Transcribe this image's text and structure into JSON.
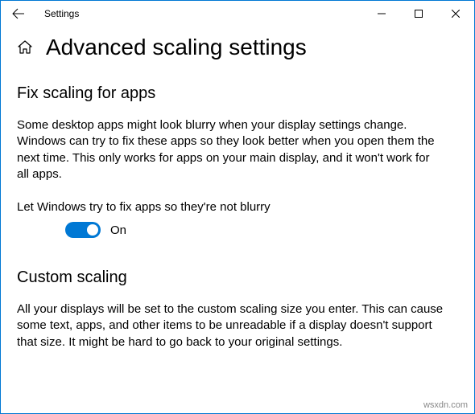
{
  "titlebar": {
    "title": "Settings"
  },
  "header": {
    "page_title": "Advanced scaling settings"
  },
  "section1": {
    "title": "Fix scaling for apps",
    "description": "Some desktop apps might look blurry when your display settings change. Windows can try to fix these apps so they look better when you open them the next time. This only works for apps on your main display, and it won't work for all apps.",
    "toggle_label": "Let Windows try to fix apps so they're not blurry",
    "toggle_state": "On"
  },
  "section2": {
    "title": "Custom scaling",
    "description": "All your displays will be set to the custom scaling size you enter. This can cause some text, apps, and other items to be unreadable if a display doesn't support that size. It might be hard to go back to your original settings."
  },
  "watermark": "wsxdn.com"
}
